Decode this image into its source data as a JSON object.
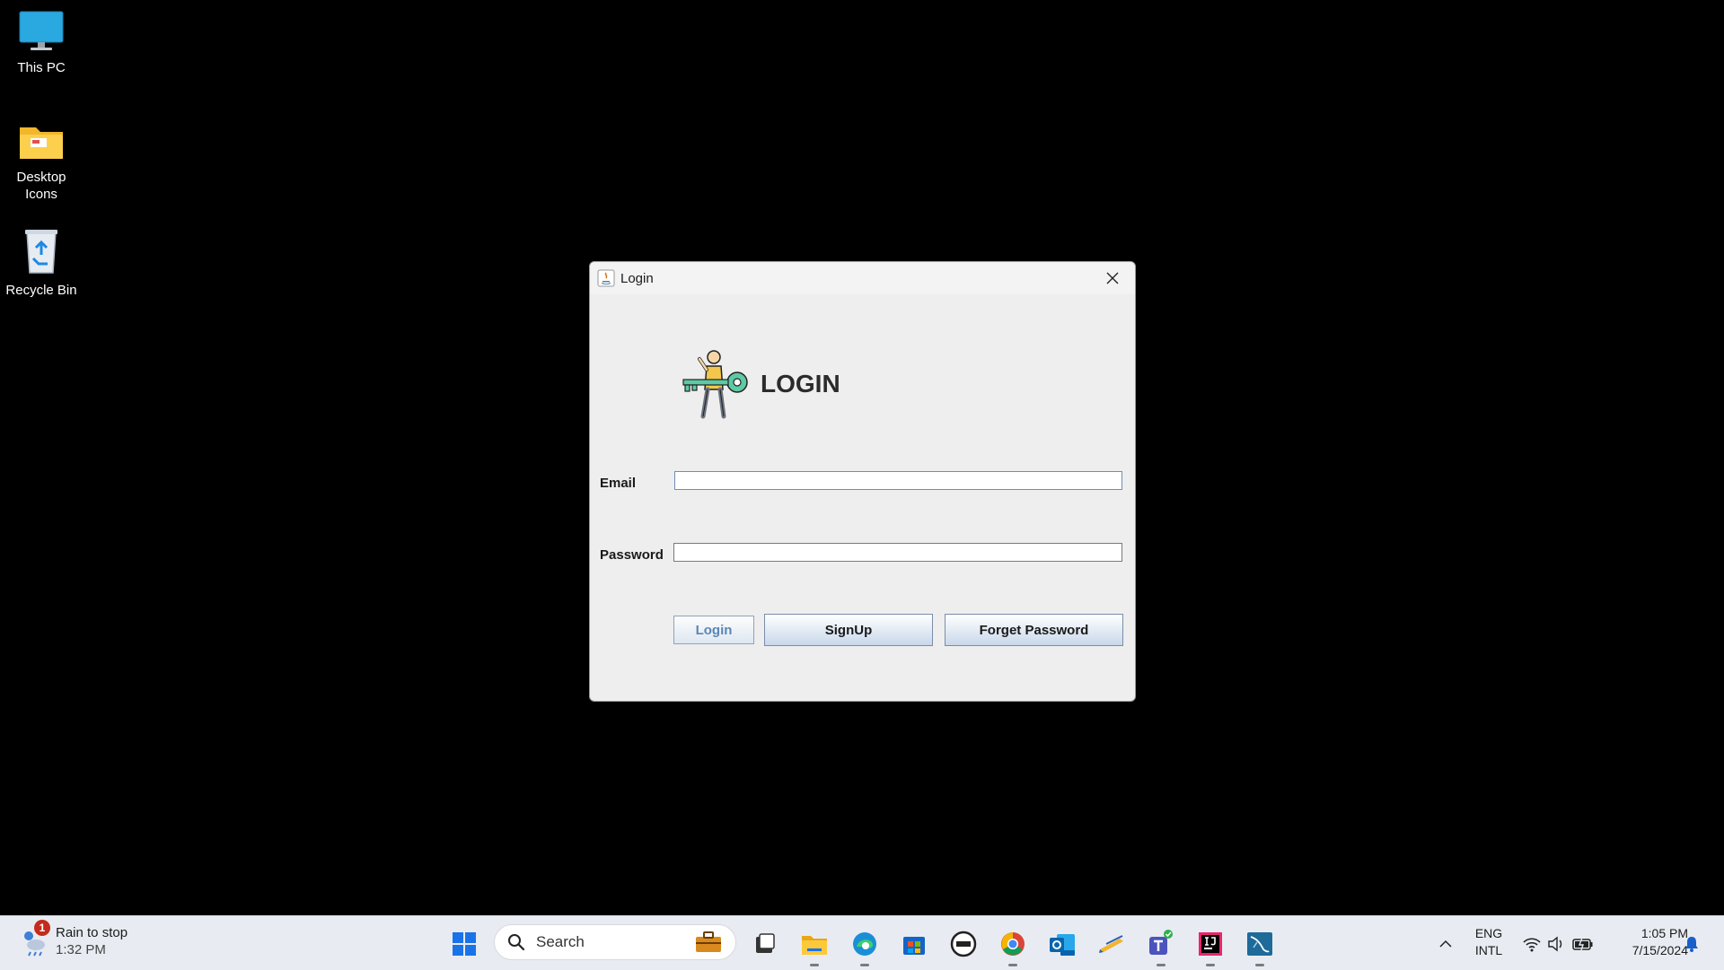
{
  "desktop": {
    "icons": [
      {
        "label": "This PC"
      },
      {
        "label": "Desktop\nIcons"
      },
      {
        "label": "Recycle Bin"
      }
    ]
  },
  "window": {
    "title": "Login",
    "heading": "LOGIN",
    "email_label": "Email",
    "email_value": "",
    "password_label": "Password",
    "password_value": "",
    "buttons": {
      "login": "Login",
      "signup": "SignUp",
      "forget": "Forget Password"
    }
  },
  "taskbar": {
    "weather": {
      "line1": "Rain to stop",
      "line2": "1:32 PM",
      "badge": "1"
    },
    "search_placeholder": "Search",
    "apps": [
      "start-icon",
      "work-bag-icon",
      "task-view-icon",
      "file-explorer-icon",
      "edge-icon",
      "store-icon",
      "dell-icon",
      "chrome-icon",
      "outlook-icon",
      "pen-tool-icon",
      "teams-icon",
      "intellij-icon",
      "mysql-workbench-icon"
    ],
    "language": {
      "line1": "ENG",
      "line2": "INTL"
    },
    "clock": {
      "time": "1:05 PM",
      "date": "7/15/2024"
    }
  },
  "colors": {
    "accent": "#0078d4",
    "window_bg": "#eeeeee",
    "login_button_text": "#5a86b5"
  }
}
